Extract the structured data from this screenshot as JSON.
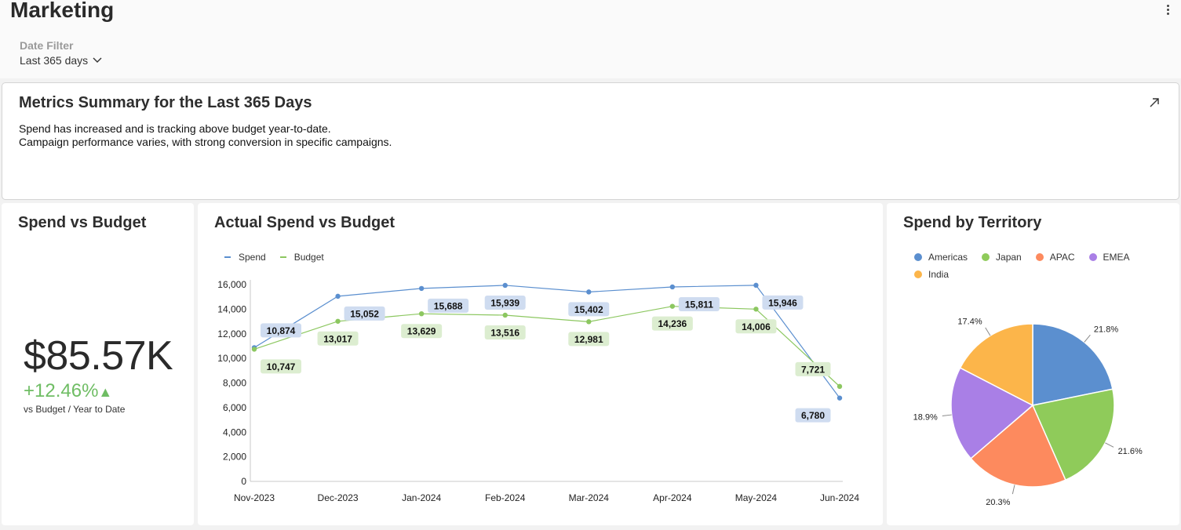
{
  "page": {
    "title": "Marketing",
    "filter_label": "Date Filter",
    "filter_value": "Last 365 days"
  },
  "summary": {
    "title": "Metrics Summary for the Last 365 Days",
    "line1": "Spend has increased and is tracking above budget year-to-date.",
    "line2": "Campaign performance varies, with strong conversion in specific campaigns."
  },
  "kpi": {
    "title": "Spend vs Budget",
    "value": "$85.57K",
    "change": "+12.46%",
    "change_icon": "▲",
    "caption": "vs Budget / Year to Date",
    "color": "#6fbd64"
  },
  "line_chart": {
    "title": "Actual Spend vs Budget"
  },
  "pie_chart": {
    "title": "Spend by Territory"
  },
  "chart_data": [
    {
      "type": "line",
      "title": "Actual Spend vs Budget",
      "categories": [
        "Nov-2023",
        "Dec-2023",
        "Jan-2024",
        "Feb-2024",
        "Mar-2024",
        "Apr-2024",
        "May-2024",
        "Jun-2024"
      ],
      "series": [
        {
          "name": "Spend",
          "color": "#5b8fcf",
          "label_bg": "#cfdcf0",
          "values": [
            10874,
            15052,
            15688,
            15939,
            15402,
            15811,
            15946,
            6780
          ]
        },
        {
          "name": "Budget",
          "color": "#8cc760",
          "label_bg": "#dcedd0",
          "values": [
            10747,
            13017,
            13629,
            13516,
            12981,
            14236,
            14006,
            7721
          ]
        }
      ],
      "yticks": [
        "0",
        "2,000",
        "4,000",
        "6,000",
        "8,000",
        "10,000",
        "12,000",
        "14,000",
        "16,000"
      ],
      "ylim": [
        0,
        16000
      ],
      "legend": "top-left",
      "grid": false
    },
    {
      "type": "pie",
      "title": "Spend by Territory",
      "legend": "top",
      "slices": [
        {
          "name": "Americas",
          "value": 21.8,
          "label": "21.8%",
          "color": "#5b8fcf"
        },
        {
          "name": "Japan",
          "value": 21.6,
          "label": "21.6%",
          "color": "#8fcb5a"
        },
        {
          "name": "APAC",
          "value": 20.3,
          "label": "20.3%",
          "color": "#fd8a5e"
        },
        {
          "name": "EMEA",
          "value": 18.9,
          "label": "18.9%",
          "color": "#a97fe6"
        },
        {
          "name": "India",
          "value": 17.4,
          "label": "17.4%",
          "color": "#fcb54a"
        }
      ]
    }
  ]
}
